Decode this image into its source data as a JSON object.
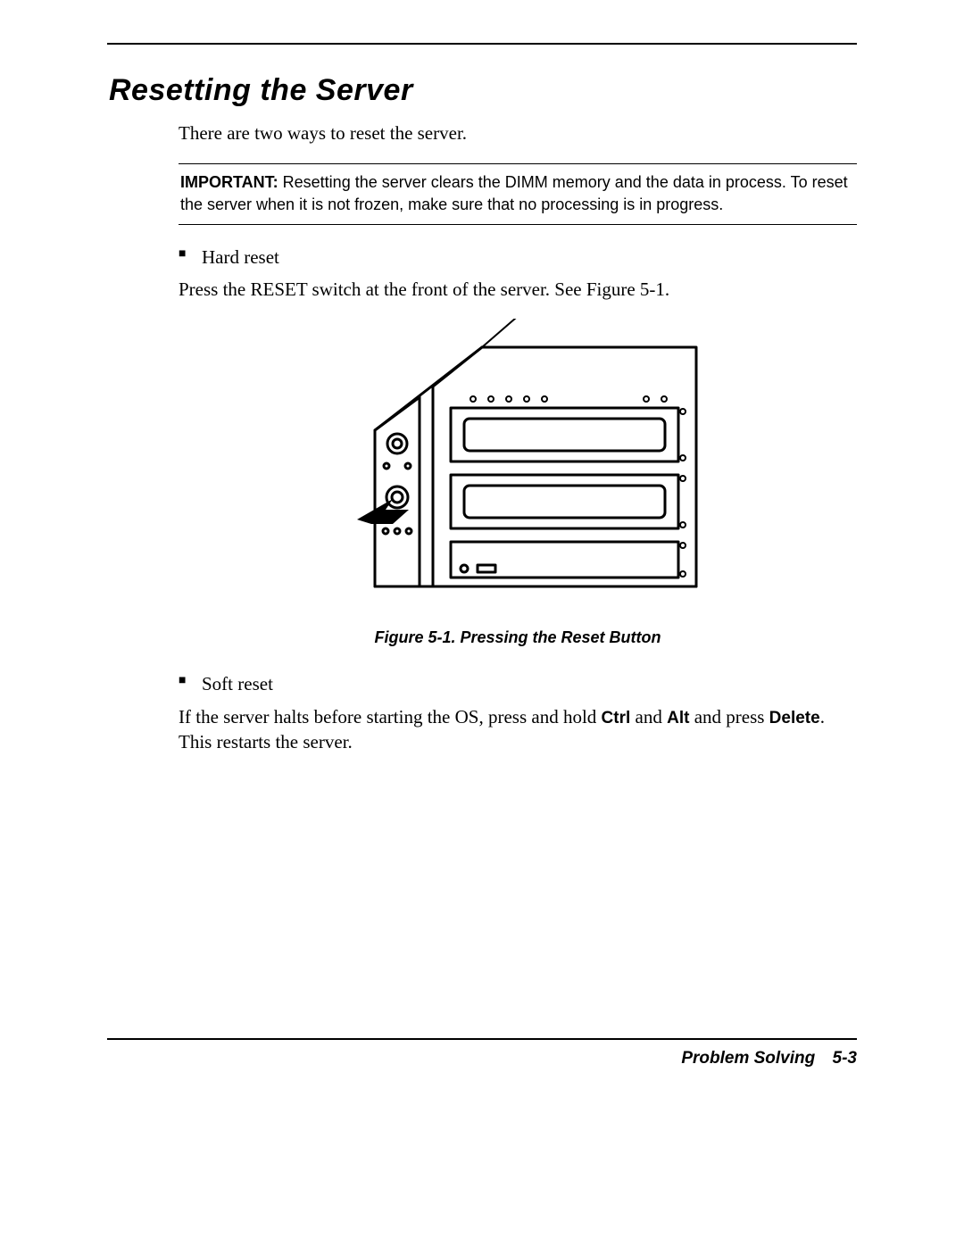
{
  "header": {
    "title": "Resetting the Server"
  },
  "intro": "There are two ways to reset the server.",
  "important": {
    "label": "IMPORTANT:",
    "text": " Resetting the server clears the DIMM memory and the data in process.  To reset the server when it is not frozen, make sure that no processing is in progress."
  },
  "hard_reset": {
    "bullet": "Hard reset",
    "text": "Press the RESET switch at the front of the server. See Figure 5-1."
  },
  "figure": {
    "caption": "Figure 5-1. Pressing the Reset Button"
  },
  "soft_reset": {
    "bullet": "Soft reset",
    "p1a": "If the server halts before starting the OS, press and hold ",
    "k1": "Ctrl",
    "p1b": " and ",
    "k2": "Alt",
    "p1c": " and press ",
    "k3": "Delete",
    "p1d": ". This restarts the server."
  },
  "footer": {
    "section": "Problem Solving",
    "page": "5-3"
  }
}
